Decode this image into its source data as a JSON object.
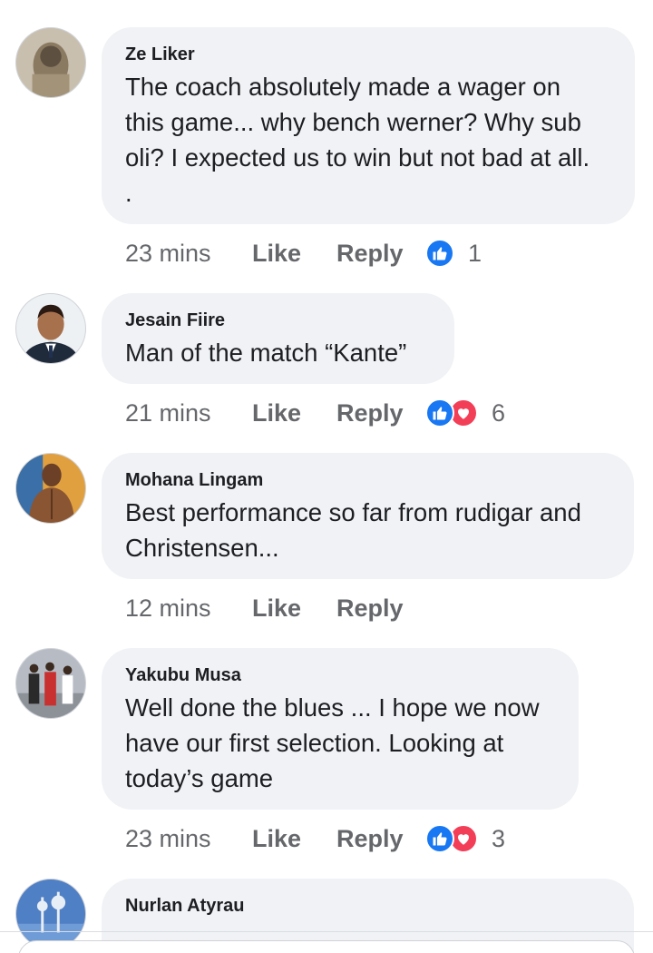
{
  "comments": [
    {
      "author": "Ze Liker",
      "text": "The coach absolutely made a wager on\nthis game... why bench werner? Why sub\noli? I expected us to win but not bad at all.\n.",
      "time": "23 mins",
      "like_label": "Like",
      "reply_label": "Reply",
      "reactions": [
        "like"
      ],
      "reaction_count": "1"
    },
    {
      "author": "Jesain Fiire",
      "text": "Man of the match “Kante”",
      "time": "21 mins",
      "like_label": "Like",
      "reply_label": "Reply",
      "reactions": [
        "like",
        "love"
      ],
      "reaction_count": "6"
    },
    {
      "author": "Mohana Lingam",
      "text": "Best performance so far from rudigar and\nChristensen...",
      "time": "12 mins",
      "like_label": "Like",
      "reply_label": "Reply",
      "reactions": [],
      "reaction_count": ""
    },
    {
      "author": "Yakubu Musa",
      "text": "Well done the blues ... I hope we now\nhave our first selection. Looking at\ntoday’s game",
      "time": "23 mins",
      "like_label": "Like",
      "reply_label": "Reply",
      "reactions": [
        "like",
        "love"
      ],
      "reaction_count": "3"
    },
    {
      "author": "Nurlan Atyrau",
      "text": "",
      "time": "",
      "like_label": "",
      "reply_label": "",
      "reactions": [],
      "reaction_count": ""
    }
  ],
  "colors": {
    "bubble": "#f0f2f5",
    "meta_text": "#65676b",
    "like_reaction": "#1877f2",
    "love_reaction": "#f33e58"
  },
  "icons": {
    "like": "thumbs-up-icon",
    "love": "heart-icon"
  }
}
